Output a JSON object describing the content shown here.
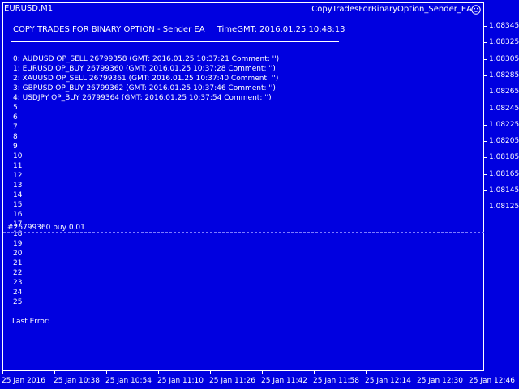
{
  "chart": {
    "symbol": "EURUSD,M1",
    "ea_name": "CopyTradesForBinaryOption_Sender_EA",
    "smiley_icon": "smiley-face-icon",
    "background_color": "#0000E0",
    "foreground_color": "#FFFFFF"
  },
  "panel": {
    "title": "COPY TRADES FOR BINARY OPTION - Sender EA",
    "time_label": "TimeGMT: 2016.01.25 10:48:13",
    "rows": [
      "0:  AUDUSD  OP_SELL  26799358  (GMT: 2016.01.25 10:37:21   Comment: '')",
      "1:  EURUSD  OP_BUY  26799360  (GMT: 2016.01.25 10:37:28   Comment: '')",
      "2:  XAUUSD  OP_SELL  26799361  (GMT: 2016.01.25 10:37:40   Comment: '')",
      "3:  GBPUSD  OP_BUY  26799362  (GMT: 2016.01.25 10:37:46   Comment: '')",
      "4:  USDJPY  OP_BUY  26799364  (GMT: 2016.01.25 10:37:54   Comment: '')",
      "5",
      "6",
      "7",
      "8",
      "9",
      "10",
      "11",
      "12",
      "13",
      "14",
      "15",
      "16",
      "17",
      "18",
      "19",
      "20",
      "21",
      "22",
      "23",
      "24",
      "25"
    ],
    "last_error": "Last Error:"
  },
  "order_line": {
    "label": "#26799360 buy 0.01"
  },
  "price_axis": [
    "1.08345",
    "1.08325",
    "1.08305",
    "1.08285",
    "1.08265",
    "1.08245",
    "1.08225",
    "1.08205",
    "1.08185",
    "1.08165",
    "1.08145",
    "1.08125"
  ],
  "time_axis": [
    "25 Jan 2016",
    "25 Jan 10:38",
    "25 Jan 10:54",
    "25 Jan 11:10",
    "25 Jan 11:26",
    "25 Jan 11:42",
    "25 Jan 11:58",
    "25 Jan 12:14",
    "25 Jan 12:30",
    "25 Jan 12:46"
  ]
}
